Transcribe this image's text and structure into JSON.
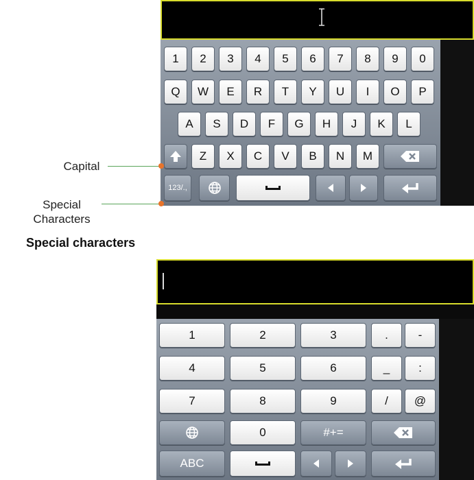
{
  "keyboard1": {
    "row1": [
      "1",
      "2",
      "3",
      "4",
      "5",
      "6",
      "7",
      "8",
      "9",
      "0"
    ],
    "row2": [
      "Q",
      "W",
      "E",
      "R",
      "T",
      "Y",
      "U",
      "I",
      "O",
      "P"
    ],
    "row3": [
      "A",
      "S",
      "D",
      "F",
      "G",
      "H",
      "J",
      "K",
      "L"
    ],
    "row4": [
      "Z",
      "X",
      "C",
      "V",
      "B",
      "N",
      "M"
    ],
    "mode_label": "123/.,",
    "icons": [
      "shift-icon",
      "backspace-icon",
      "globe-icon",
      "space-icon",
      "arrow-left-icon",
      "arrow-right-icon",
      "enter-icon",
      "text-cursor-icon"
    ]
  },
  "callouts": {
    "capital": "Capital",
    "special_line1": "Special",
    "special_line2": "Characters"
  },
  "section_heading": "Special characters",
  "keyboard2": {
    "row1": [
      "1",
      "2",
      "3",
      ".",
      "-"
    ],
    "row2": [
      "4",
      "5",
      "6",
      "_",
      ":"
    ],
    "row3": [
      "7",
      "8",
      "9",
      "/",
      "@"
    ],
    "zero": "0",
    "symbols_label": "#+=",
    "abc_label": "ABC"
  },
  "colors": {
    "input_border": "#d8dc2c",
    "callout_line": "#5aa55a",
    "callout_dot": "#e8742b"
  }
}
